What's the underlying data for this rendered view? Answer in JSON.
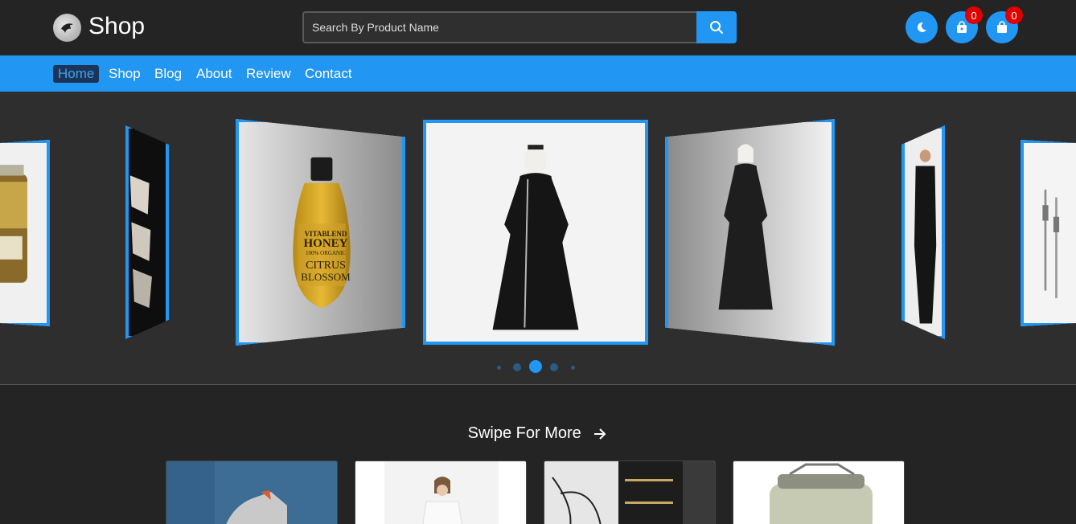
{
  "header": {
    "brand": "Shop",
    "logo_icon": "eagle-logo-icon",
    "search": {
      "placeholder": "Search By Product Name",
      "value": ""
    },
    "search_icon": "search-icon",
    "theme_icon": "moon-icon",
    "wishlist_icon": "shopping-bag-icon",
    "wishlist_count": "0",
    "cart_icon": "shopping-bag-solid-icon",
    "cart_count": "0"
  },
  "nav": {
    "items": [
      {
        "label": "Home",
        "active": true
      },
      {
        "label": "Shop",
        "active": false
      },
      {
        "label": "Blog",
        "active": false
      },
      {
        "label": "About",
        "active": false
      },
      {
        "label": "Review",
        "active": false
      },
      {
        "label": "Contact",
        "active": false
      }
    ]
  },
  "carousel": {
    "honey_label": {
      "brand": "VITABLEND",
      "product": "HONEY",
      "tagline": "100% ORGANIC",
      "flavor": "CITRUS",
      "flavor2": "BLOSSOM"
    },
    "pagination": {
      "total": 5,
      "active_index": 2
    }
  },
  "swipe": {
    "label": "Swipe For More",
    "arrow_icon": "arrow-right-icon"
  },
  "colors": {
    "accent": "#2196f3",
    "background": "#242424",
    "badge": "#e00000"
  }
}
